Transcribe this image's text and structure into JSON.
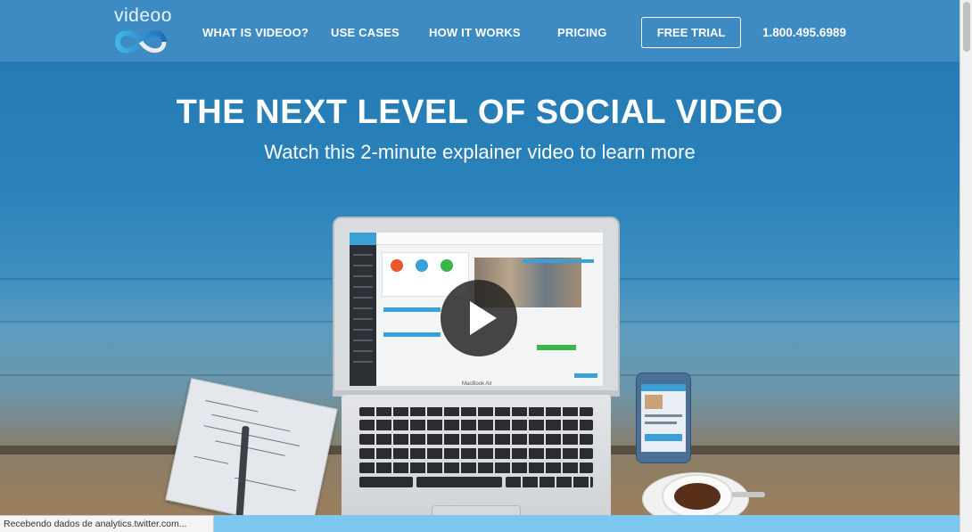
{
  "logo": {
    "text": "videoo",
    "icon": "infinity-logo-icon"
  },
  "nav": {
    "links": [
      {
        "label": "WHAT IS VIDEOO?"
      },
      {
        "label": "USE CASES"
      },
      {
        "label": "HOW IT WORKS"
      },
      {
        "label": "PRICING"
      }
    ],
    "trial_button": "FREE TRIAL",
    "phone": "1.800.495.6989"
  },
  "hero": {
    "title": "THE NEXT LEVEL OF SOCIAL VIDEO",
    "subtitle": "Watch this 2-minute explainer video to learn more",
    "play_icon": "play-icon",
    "laptop_brand": "MacBook Air"
  },
  "status_bar": {
    "text": "Recebendo dados de analytics.twitter.com..."
  },
  "colors": {
    "nav_bg": "#3d8bc2",
    "hero_blue": "#2377b0",
    "accent_light_blue": "#7cc8ef"
  }
}
